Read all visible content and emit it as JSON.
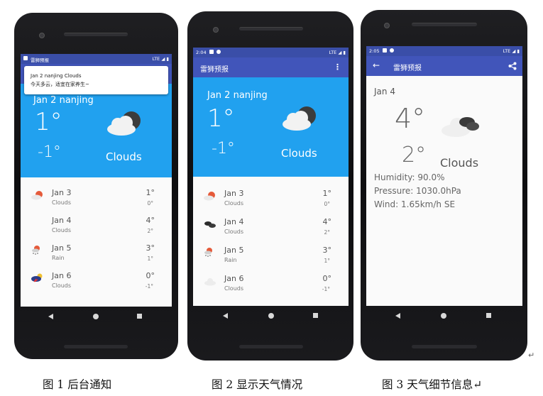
{
  "colors": {
    "toolbar": "#4155ba",
    "statusbar": "#3a4ea8",
    "hero": "#21a1ef",
    "background": "#fafafa"
  },
  "phone1": {
    "app_name": "雷狮预报",
    "status_right": "LTE",
    "notification": {
      "title": "Jan 2 nanjing Clouds",
      "text": "今天多云，适宜在家养生~"
    },
    "hero": {
      "date": "Jan 2 nanjing",
      "high": "1°",
      "low": "-1°",
      "condition": "Clouds",
      "icon": "cloud-dark-icon"
    },
    "forecast": [
      {
        "date": "Jan 3",
        "condition": "Clouds",
        "high": "1°",
        "low": "0°",
        "icon": "sun-cloud-icon"
      },
      {
        "date": "Jan 4",
        "condition": "Clouds",
        "high": "4°",
        "low": "2°",
        "icon": ""
      },
      {
        "date": "Jan 5",
        "condition": "Rain",
        "high": "3°",
        "low": "1°",
        "icon": "rain-icon"
      },
      {
        "date": "Jan 6",
        "condition": "Clouds",
        "high": "0°",
        "low": "-1°",
        "icon": "storm-icon"
      }
    ]
  },
  "phone2": {
    "time": "2:04",
    "status_right": "LTE",
    "app_title": "雷狮预报",
    "menu_icon": "more-vert-icon",
    "hero": {
      "date": "Jan 2 nanjing",
      "high": "1°",
      "low": "-1°",
      "condition": "Clouds",
      "icon": "cloud-dark-icon"
    },
    "forecast": [
      {
        "date": "Jan 3",
        "condition": "Clouds",
        "high": "1°",
        "low": "0°",
        "icon": "sun-cloud-icon"
      },
      {
        "date": "Jan 4",
        "condition": "Clouds",
        "high": "4°",
        "low": "2°",
        "icon": "dark-clouds-icon"
      },
      {
        "date": "Jan 5",
        "condition": "Rain",
        "high": "3°",
        "low": "1°",
        "icon": "rain-icon"
      },
      {
        "date": "Jan 6",
        "condition": "Clouds",
        "high": "0°",
        "low": "-1°",
        "icon": "light-cloud-icon"
      }
    ]
  },
  "phone3": {
    "time": "2:05",
    "status_right": "LTE",
    "app_title": "雷狮预报",
    "back_icon": "arrow-back-icon",
    "share_icon": "share-icon",
    "date": "Jan 4",
    "high": "4°",
    "low": "2°",
    "condition": "Clouds",
    "humidity": "Humidity: 90.0%",
    "pressure": "Pressure: 1030.0hPa",
    "wind": "Wind: 1.65km/h SE"
  },
  "captions": {
    "fig1": "图 1 后台通知",
    "fig2": "图 2 显示天气情况",
    "fig3": "图 3 天气细节信息↵",
    "return_mark": "↵"
  }
}
